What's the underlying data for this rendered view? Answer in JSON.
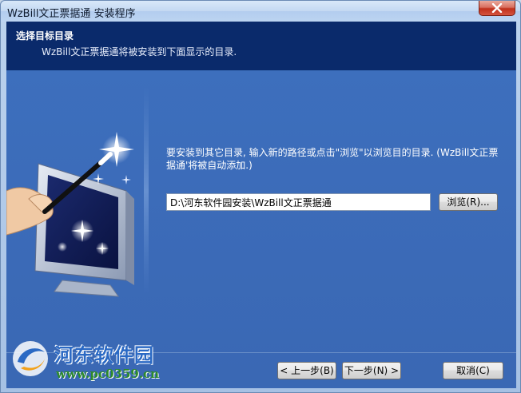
{
  "window": {
    "title": "WzBill文正票据通 安装程序"
  },
  "header": {
    "title": "选择目标目录",
    "subtitle": "WzBill文正票据通将被安装到下面显示的目录."
  },
  "main": {
    "description": "要安装到其它目录, 输入新的路径或点击\"浏览\"以浏览目的目录. (WzBill文正票据通'将被自动添加.)",
    "path_value": "D:\\河东软件园安装\\WzBill文正票据通",
    "browse_label": "浏览(R)..."
  },
  "footer": {
    "back_label": "< 上一步(B)",
    "next_label": "下一步(N) >",
    "cancel_label": "取消(C)"
  },
  "watermark": {
    "name": "河东软件园",
    "url": "www.pc0359.cn"
  },
  "icons": {
    "close": "close-icon",
    "wizard_art": "magic-wand-monitor-illustration",
    "site_logo": "site-logo-icon"
  },
  "colors": {
    "header_bg": "#0a2a6b",
    "body_bg": "#3a6cb8",
    "close_btn": "#c0301b"
  }
}
